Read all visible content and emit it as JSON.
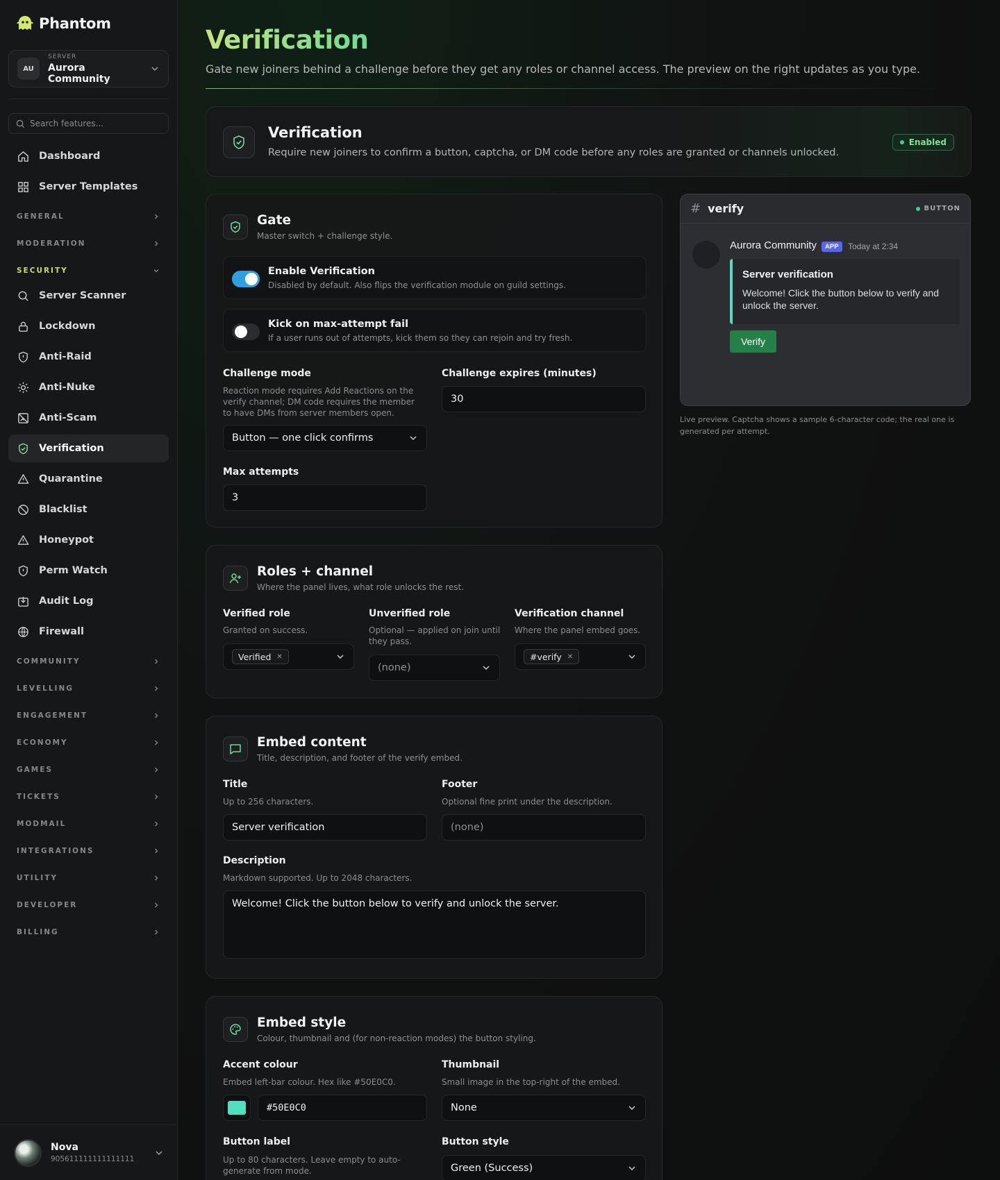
{
  "brand": {
    "name": "Phantom"
  },
  "server": {
    "caption": "SERVER",
    "initials": "AU",
    "name": "Aurora Community"
  },
  "search": {
    "placeholder": "Search features..."
  },
  "nav": {
    "dashboard": "Dashboard",
    "templates": "Server Templates",
    "sections": {
      "general": "GENERAL",
      "moderation": "MODERATION",
      "security": "SECURITY",
      "community": "COMMUNITY",
      "levelling": "LEVELLING",
      "engagement": "ENGAGEMENT",
      "economy": "ECONOMY",
      "games": "GAMES",
      "tickets": "TICKETS",
      "modmail": "MODMAIL",
      "integrations": "INTEGRATIONS",
      "utility": "UTILITY",
      "developer": "DEVELOPER",
      "billing": "BILLING"
    },
    "security_items": {
      "scanner": "Server Scanner",
      "lockdown": "Lockdown",
      "antiraid": "Anti-Raid",
      "antinuke": "Anti-Nuke",
      "antiscam": "Anti-Scam",
      "verification": "Verification",
      "quarantine": "Quarantine",
      "blacklist": "Blacklist",
      "honeypot": "Honeypot",
      "permwatch": "Perm Watch",
      "auditlog": "Audit Log",
      "firewall": "Firewall"
    }
  },
  "user": {
    "name": "Nova",
    "id": "905611111111111111"
  },
  "page": {
    "title": "Verification",
    "subtitle": "Gate new joiners behind a challenge before they get any roles or channel access. The preview on the right updates as you type."
  },
  "hero": {
    "title": "Verification",
    "description": "Require new joiners to confirm a button, captcha, or DM code before any roles are granted or channels unlocked.",
    "status": "Enabled"
  },
  "gate": {
    "title": "Gate",
    "subtitle": "Master switch + challenge style.",
    "enable": {
      "label": "Enable Verification",
      "help": "Disabled by default. Also flips the verification module on guild settings.",
      "on": true
    },
    "kick": {
      "label": "Kick on max-attempt fail",
      "help": "If a user runs out of attempts, kick them so they can rejoin and try fresh.",
      "on": false
    },
    "challenge_mode": {
      "label": "Challenge mode",
      "help": "Reaction mode requires Add Reactions on the verify channel; DM code requires the member to have DMs from server members open.",
      "value": "Button — one click confirms"
    },
    "expires": {
      "label": "Challenge expires (minutes)",
      "value": "30"
    },
    "max_attempts": {
      "label": "Max attempts",
      "value": "3"
    }
  },
  "roles": {
    "title": "Roles + channel",
    "subtitle": "Where the panel lives, what role unlocks the rest.",
    "verified": {
      "label": "Verified role",
      "help": "Granted on success.",
      "value": "Verified"
    },
    "unverified": {
      "label": "Unverified role",
      "help": "Optional — applied on join until they pass.",
      "value": "(none)"
    },
    "channel": {
      "label": "Verification channel",
      "help": "Where the panel embed goes.",
      "value": "#verify"
    }
  },
  "embed_content": {
    "title": "Embed content",
    "subtitle": "Title, description, and footer of the verify embed.",
    "title_field": {
      "label": "Title",
      "help": "Up to 256 characters.",
      "value": "Server verification"
    },
    "footer_field": {
      "label": "Footer",
      "help": "Optional fine print under the description.",
      "value": "(none)"
    },
    "description_field": {
      "label": "Description",
      "help": "Markdown supported. Up to 2048 characters.",
      "value": "Welcome! Click the button below to verify and unlock the server."
    }
  },
  "embed_style": {
    "title": "Embed style",
    "subtitle": "Colour, thumbnail and (for non-reaction modes) the button styling.",
    "accent": {
      "label": "Accent colour",
      "help": "Embed left-bar colour. Hex like #50E0C0.",
      "value": "#50E0C0",
      "color": "#50E0C0"
    },
    "thumbnail": {
      "label": "Thumbnail",
      "help": "Small image in the top-right of the embed.",
      "value": "None"
    },
    "button_label": {
      "label": "Button label",
      "help": "Up to 80 characters. Leave empty to auto-generate from mode."
    },
    "button_style": {
      "label": "Button style",
      "value": "Green (Success)"
    }
  },
  "preview": {
    "channel": "verify",
    "kind": "BUTTON",
    "bot_name": "Aurora Community",
    "app_tag": "APP",
    "time": "Today at 2:34",
    "embed_title": "Server verification",
    "embed_description": "Welcome! Click the button below to verify and unlock the server.",
    "button": "Verify",
    "note": "Live preview. Captcha shows a sample 6-character code; the real one is generated per attempt."
  }
}
